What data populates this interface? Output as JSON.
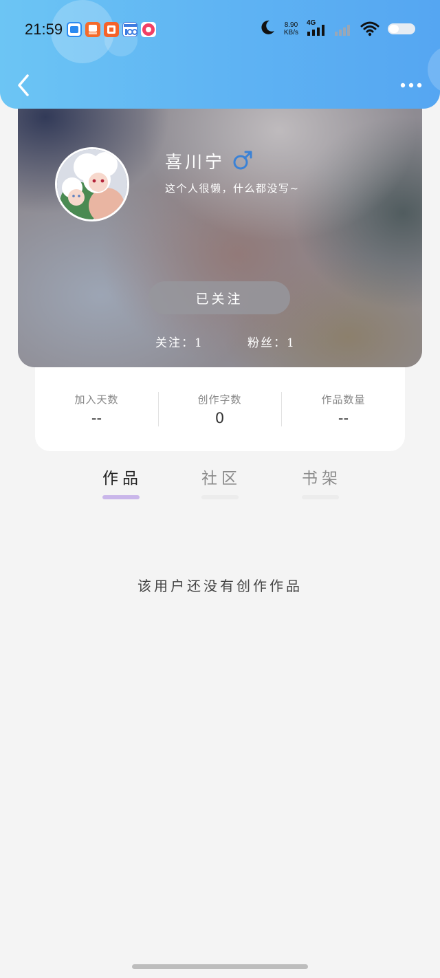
{
  "status_bar": {
    "time": "21:59",
    "speed_value": "8.90",
    "speed_unit": "KB/s",
    "network": "4G",
    "app_icons": [
      "app-blue-icon",
      "app-orange-icon",
      "app-orange-icon-2",
      "app-100-icon",
      "app-pink-icon"
    ]
  },
  "nav": {
    "back_icon": "chevron-left-icon",
    "more_icon": "more-dots-icon"
  },
  "profile": {
    "username": "喜川宁",
    "gender_icon": "male-icon",
    "bio": "这个人很懒，什么都没写~",
    "follow_button": "已关注",
    "following": "关注：1",
    "followers": "粉丝：1"
  },
  "stats": [
    {
      "label": "加入天数",
      "value": "--"
    },
    {
      "label": "创作字数",
      "value": "0"
    },
    {
      "label": "作品数量",
      "value": "--"
    }
  ],
  "tabs": [
    {
      "label": "作品",
      "active": true
    },
    {
      "label": "社区",
      "active": false
    },
    {
      "label": "书架",
      "active": false
    }
  ],
  "empty_message": "该用户还没有创作作品",
  "colors": {
    "header_gradient_start": "#6cc5f4",
    "header_gradient_end": "#55a6f2",
    "tab_active_underline": "#c9b6ea",
    "tab_inactive_underline": "#ececec",
    "gender_color": "#3b82d6"
  }
}
